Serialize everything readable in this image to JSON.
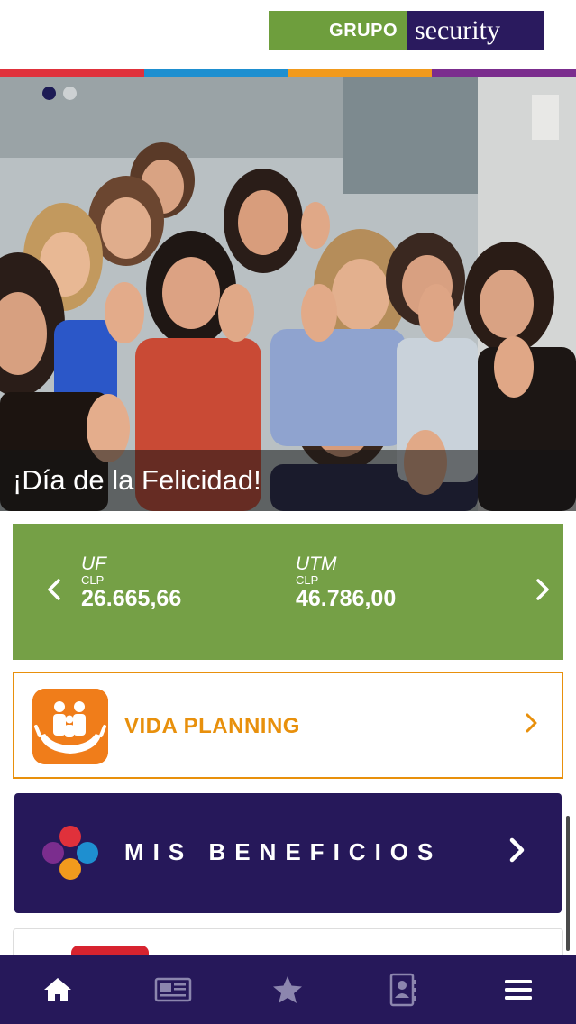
{
  "header": {
    "logo": {
      "grupo": "GRUPO",
      "security": "security"
    },
    "strip_colors": [
      "#e0313b",
      "#1e8fd0",
      "#f19a1d",
      "#7b2d8e"
    ]
  },
  "hero": {
    "caption": "¡Día de la Felicidad!",
    "slides_dots": 2,
    "active_dot": 0
  },
  "indicators": {
    "prev_icon": "chevron-left-icon",
    "next_icon": "chevron-right-icon",
    "items": [
      {
        "name": "UF",
        "currency": "CLP",
        "value": "26.665,66"
      },
      {
        "name": "UTM",
        "currency": "CLP",
        "value": "46.786,00"
      }
    ]
  },
  "vida_planning": {
    "label": "VIDA PLANNING",
    "icon": "family-hands-icon",
    "arrow_icon": "chevron-right-icon"
  },
  "beneficios": {
    "label": "MIS BENEFICIOS",
    "icon": "four-dots-icon",
    "arrow_icon": "chevron-right-icon",
    "dot_colors": [
      "#e0313b",
      "#1e8fd0",
      "#f19a1d",
      "#7b2d8e"
    ]
  },
  "bottom_nav": {
    "items": [
      "home-icon",
      "news-icon",
      "star-icon",
      "contacts-icon",
      "menu-icon"
    ],
    "active": "home-icon"
  },
  "colors": {
    "brand_green": "#75a046",
    "brand_purple": "#26185a",
    "accent_orange": "#e8900c"
  }
}
